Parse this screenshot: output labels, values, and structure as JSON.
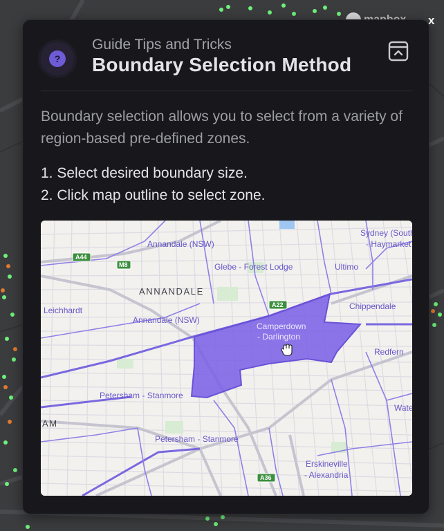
{
  "background": {
    "brand_text": "mapbox",
    "close_label": "x"
  },
  "modal": {
    "subtitle": "Guide Tips and Tricks",
    "title": "Boundary Selection Method",
    "description": "Boundary selection allows you to select from a variety of region-based pre-defined zones.",
    "steps": [
      "1. Select desired boundary size.",
      "2. Click map outline to select zone."
    ],
    "help_icon_glyph": "?",
    "collapse_icon": "collapse-panel-icon"
  },
  "map_preview": {
    "labels": {
      "annandale_nsw_top": "Annandale (NSW)",
      "glebe": "Glebe - Forest Lodge",
      "ultimo": "Ultimo",
      "sydney_south": "Sydney (South)",
      "haymarket": "- Haymarket",
      "annandale_caps": "ANNANDALE",
      "leichhardt": "Leichhardt",
      "annandale_nsw_mid": "Annandale (NSW)",
      "chippendale": "Chippendale",
      "camperdown_1": "Camperdown",
      "camperdown_2": "- Darlington",
      "redfern": "Redfern",
      "petersham_1": "Petersham - Stanmore",
      "petersham_2": "Petersham - Stanmore",
      "am": "AM",
      "waterloo": "Wate",
      "erskineville_1": "Erskineville",
      "erskineville_2": "- Alexandria"
    },
    "shields": {
      "a44": "A44",
      "m8": "M8",
      "a22": "A22",
      "a36": "A36"
    },
    "colors": {
      "selected_zone": "#7b62e6",
      "boundary_line": "#7a68e0",
      "shield_green": "#3b8f3e"
    },
    "cursor_icon": "hand-cursor-icon"
  }
}
